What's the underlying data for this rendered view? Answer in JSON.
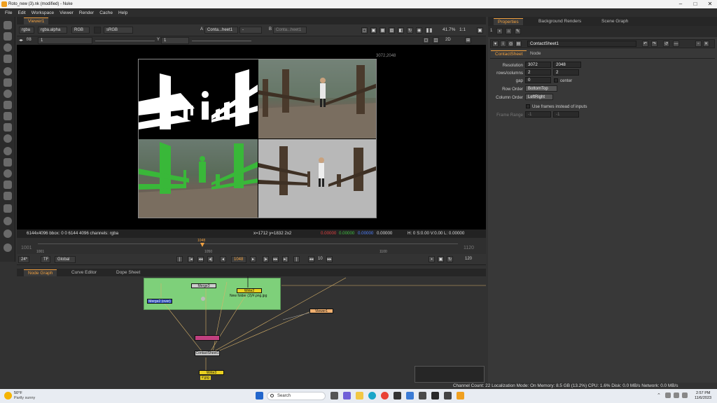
{
  "window": {
    "title": "Roto_new (3).nk (modified) - Nuke"
  },
  "menu": [
    "File",
    "Edit",
    "Workspace",
    "Viewer",
    "Render",
    "Cache",
    "Help"
  ],
  "viewer": {
    "tab": "Viewer1",
    "channels": "rgba",
    "channel_sel": "rgba.alpha",
    "display": "RGB",
    "colorspace": "sRGB",
    "a_input_label": "A",
    "a_input": "Conta...heet1",
    "a_op": "-",
    "b_input_label": "B",
    "b_input": "Conta...heet1",
    "fstop": "f/8",
    "frame_step": "1",
    "y_label": "Y",
    "y_val": "1",
    "zoom": "41.7%",
    "ratio": "1:1",
    "mode": "2D",
    "format_label": "3072,2048",
    "info_left": "6144x4096  bbox: 0 0 6144 4096 channels: rgba",
    "info_pos": "x=1712 y=1832 2x2",
    "info_r": "0.00000",
    "info_g": "0.00000",
    "info_b": "0.00000",
    "info_a": "0.00000",
    "info_hsv": "H:   0 S:0.00 V:0.00   L: 0.00000"
  },
  "timeline": {
    "start": "1001",
    "end": "1120",
    "tick_1050": "1050",
    "tick_1100": "1100",
    "current": "1048",
    "fps": "24*",
    "tf": "TF",
    "scope": "Global",
    "frame_field": "1048",
    "increment": "10",
    "end_field": "120"
  },
  "nodegraph": {
    "tabs": [
      "Node Graph",
      "Curve Editor",
      "Dope Sheet"
    ],
    "nodes": {
      "merge": "Merge3",
      "write2": "Write2",
      "write2_path": "New folder (2)/#.png.jpg",
      "merge_left": "Merge2 (over)",
      "viewer": "Viewer1",
      "contact": "ContactSheet1",
      "write_bottom": "Write3",
      "write_bottom_path": "#.jpg"
    }
  },
  "properties": {
    "tabs": [
      "Properties",
      "Background Renders",
      "Scene Graph"
    ],
    "count": "1",
    "node_name": "ContactSheet1",
    "subtabs": [
      "ContactSheet",
      "Node"
    ],
    "resolution_label": "Resolution",
    "resolution_w": "3072",
    "resolution_h": "2048",
    "rows_label": "rows/columns",
    "rows": "2",
    "columns": "2",
    "gap_label": "gap",
    "gap": "0",
    "center_label": "center",
    "row_order_label": "Row Order",
    "row_order": "BottomTop",
    "col_order_label": "Column Order",
    "col_order": "LeftRight",
    "use_frames_label": "Use frames instead of inputs",
    "frame_range_label": "Frame Range",
    "frame_start": "-1",
    "frame_end": "-1"
  },
  "status": "Channel Count: 22  Localization Mode: On  Memory: 8.5 GB (13.2%)  CPU: 1.6%  Disk: 0.0 MB/s  Network: 0.0 MB/s",
  "taskbar": {
    "weather_temp": "50°F",
    "weather_desc": "Partly sunny",
    "search": "Search",
    "time": "2:57 PM",
    "date": "11/6/2023"
  },
  "colors": {
    "accent": "#f0a040",
    "matte_green": "#39b839",
    "node_group": "#7ed07a"
  }
}
